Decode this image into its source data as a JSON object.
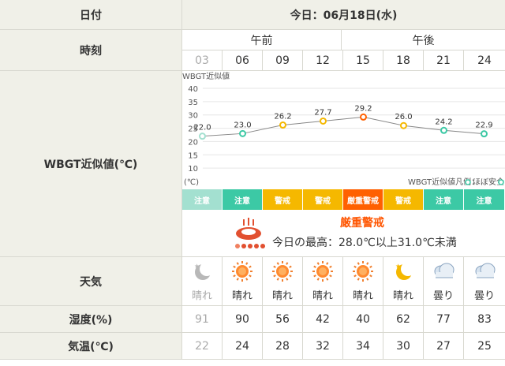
{
  "header": {
    "date_label": "日付",
    "date_value": "今日：06月18日(水)"
  },
  "time_row": {
    "label": "時刻",
    "am": "午前",
    "pm": "午後",
    "hours": [
      "03",
      "06",
      "09",
      "12",
      "15",
      "18",
      "21",
      "24"
    ]
  },
  "wbgt": {
    "label": "WBGT近似値(℃)",
    "levels": [
      "注意",
      "注意",
      "警戒",
      "警戒",
      "厳重警戒",
      "警戒",
      "注意",
      "注意"
    ],
    "level_colors": [
      "#a3e0d0",
      "#3cc9a5",
      "#f5b800",
      "#f5b800",
      "#ff6000",
      "#f5b800",
      "#3cc9a5",
      "#3cc9a5"
    ],
    "summary_level": "厳重警戒",
    "summary_level_color": "#ff5500",
    "summary_text": "今日の最高：28.0℃以上31.0℃未満",
    "legend_text": "WBGT近似値凡例：",
    "legend_item": "ほぼ安全"
  },
  "chart_data": {
    "type": "line",
    "ylabel": "WBGT近似値",
    "yunit": "(℃)",
    "ylim": [
      5,
      40
    ],
    "yticks": [
      10,
      15,
      20,
      25,
      30,
      35,
      40
    ],
    "x": [
      "03",
      "06",
      "09",
      "12",
      "15",
      "18",
      "21",
      "24"
    ],
    "values": [
      22.0,
      23.0,
      26.2,
      27.7,
      29.2,
      26.0,
      24.2,
      22.9
    ],
    "labels": [
      "22.0",
      "23.0",
      "26.2",
      "27.7",
      "29.2",
      "26.0",
      "24.2",
      "22.9"
    ],
    "point_colors": [
      "#a3e0d0",
      "#3cc9a5",
      "#f5b800",
      "#f5b800",
      "#ff6000",
      "#f5b800",
      "#3cc9a5",
      "#3cc9a5"
    ],
    "grid": true
  },
  "weather": {
    "label": "天気",
    "items": [
      {
        "icon": "moon-icon",
        "text": "晴れ"
      },
      {
        "icon": "sun-icon",
        "text": "晴れ"
      },
      {
        "icon": "sun-icon",
        "text": "晴れ"
      },
      {
        "icon": "sun-icon",
        "text": "晴れ"
      },
      {
        "icon": "sun-icon",
        "text": "晴れ"
      },
      {
        "icon": "moon-icon",
        "text": "晴れ"
      },
      {
        "icon": "cloud-icon",
        "text": "曇り"
      },
      {
        "icon": "cloud-icon",
        "text": "曇り"
      }
    ]
  },
  "humidity": {
    "label": "湿度(%)",
    "values": [
      "91",
      "90",
      "56",
      "42",
      "40",
      "62",
      "77",
      "83"
    ]
  },
  "temperature": {
    "label": "気温(℃)",
    "values": [
      "22",
      "24",
      "28",
      "32",
      "34",
      "30",
      "27",
      "25"
    ]
  }
}
